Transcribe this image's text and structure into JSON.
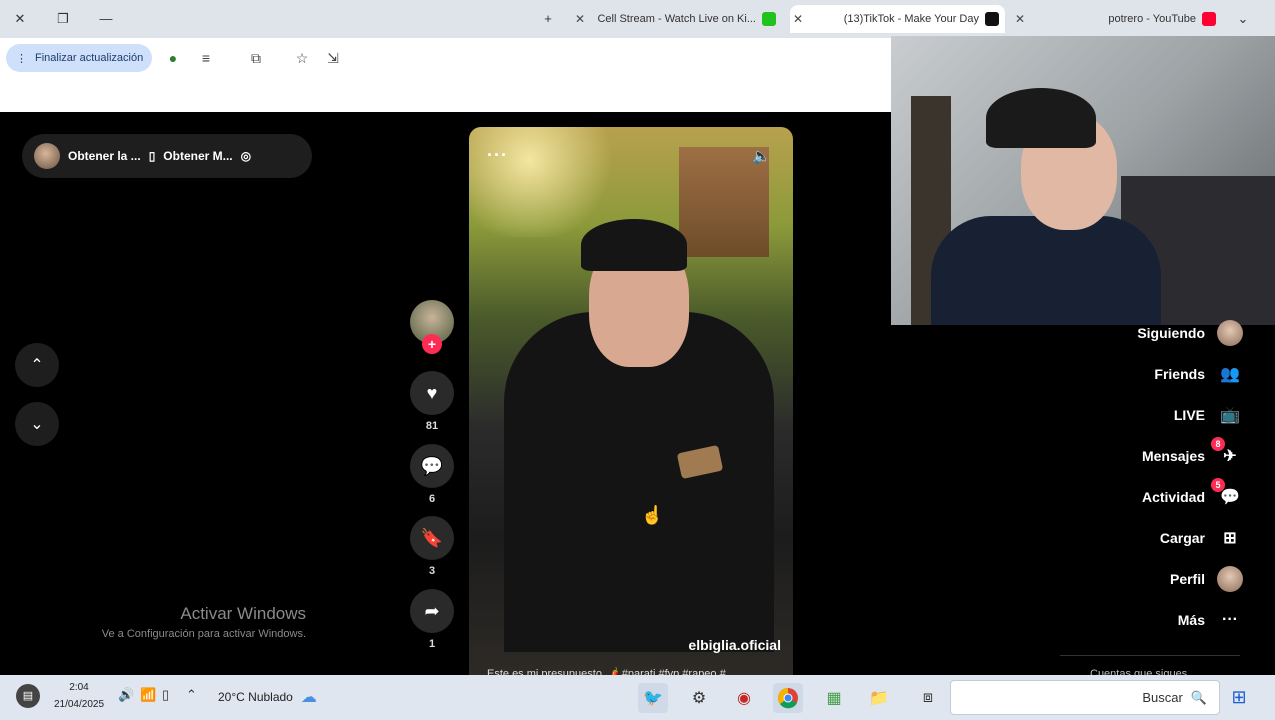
{
  "browser": {
    "tabs": [
      {
        "title": "potrero - YouTube",
        "favicon_color": "#ff0033",
        "active": false
      },
      {
        "title": "(13)TikTok - Make Your Day",
        "favicon_color": "#111111",
        "active": true
      },
      {
        "title": "Cell Stream - Watch Live on Ki...",
        "favicon_color": "#21c21e",
        "active": false
      }
    ],
    "new_tab": "+",
    "update_button": "Finalizar actualización",
    "window_controls": {
      "minimize": "—",
      "restore": "❐",
      "close": "✕"
    }
  },
  "promo": {
    "items": [
      "Obtener M...",
      "Obtener la ..."
    ]
  },
  "video": {
    "username": "elbiglia.oficial",
    "caption": "Este es mi presupuesto 🌶️ #parati #fyp #rapeo #..."
  },
  "actions": {
    "likes": "81",
    "comments": "6",
    "saves": "3",
    "shares": "1"
  },
  "sidebar": {
    "items": [
      {
        "label": "Siguiendo",
        "icon": "avatar"
      },
      {
        "label": "Friends",
        "icon": "friends-icon",
        "glyph": "👥"
      },
      {
        "label": "LIVE",
        "icon": "live-icon",
        "glyph": "📺"
      },
      {
        "label": "Mensajes",
        "icon": "messages-icon",
        "glyph": "✈",
        "badge": "8"
      },
      {
        "label": "Actividad",
        "icon": "activity-icon",
        "glyph": "💬",
        "badge": "5"
      },
      {
        "label": "Cargar",
        "icon": "upload-icon",
        "glyph": "⊞"
      },
      {
        "label": "Perfil",
        "icon": "avatar"
      },
      {
        "label": "Más",
        "icon": "more-icon",
        "glyph": "···"
      }
    ],
    "footer": "Cuentas que sigues"
  },
  "windows_watermark": {
    "title": "Activar Windows",
    "subtitle": "Ve a Configuración para activar Windows."
  },
  "taskbar": {
    "search_placeholder": "Buscar",
    "weather": "20°C Nublado",
    "time": "2:04",
    "date": "21/04/2025"
  }
}
